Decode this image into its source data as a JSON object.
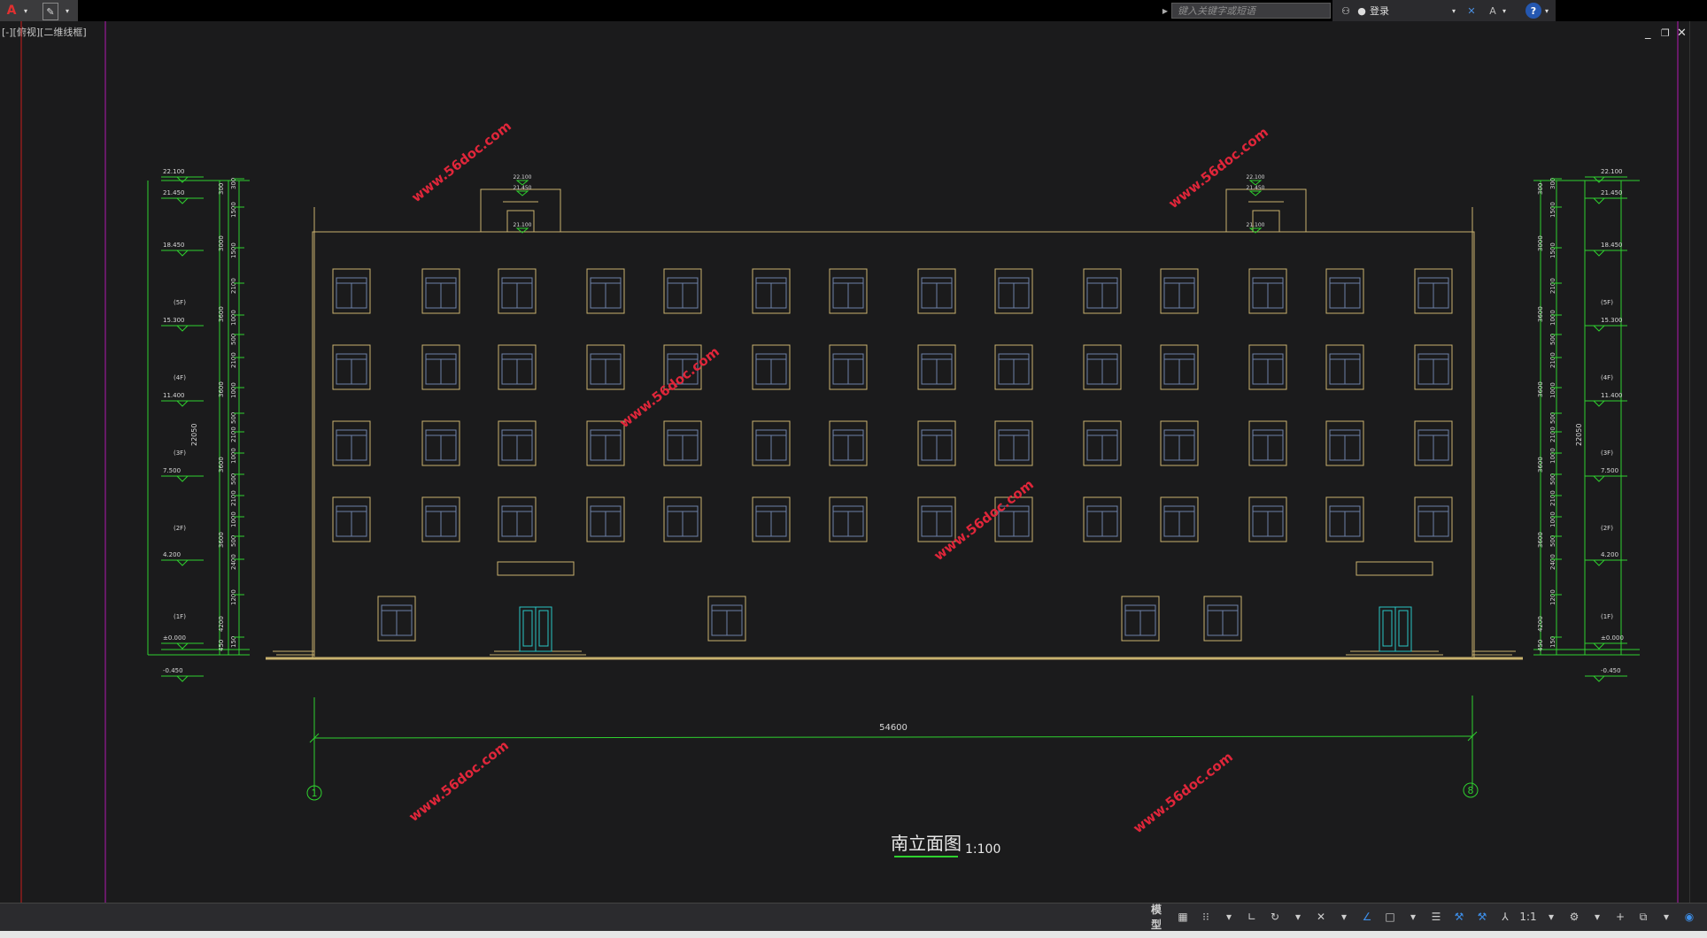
{
  "toolbar": {
    "app_menu_icon": "autocad-a-icon",
    "search_placeholder": "键入关键字或短语",
    "login_label": "登录"
  },
  "viewport": {
    "label": "[-][俯视][二维线框]"
  },
  "drawing": {
    "title": "南立面图",
    "scale": "1:100",
    "overall_dimension": "54600",
    "axis_left": "1",
    "axis_right": "8",
    "watermark": "www.56doc.com",
    "left_total_height": "22050",
    "right_total_height": "22050",
    "levels_left": [
      "22.100",
      "21.450",
      "18.450",
      "15.300",
      "11.400",
      "7.500",
      "4.200",
      "±0.000",
      "-0.450"
    ],
    "levels_right": [
      "22.100",
      "21.450",
      "18.450",
      "15.300",
      "11.400",
      "7.500",
      "4.200",
      "±0.000",
      "-0.450"
    ],
    "floor_labels": [
      "(5F)",
      "(4F)",
      "(3F)",
      "(2F)",
      "(1F)"
    ],
    "left_dims_inner": [
      "300",
      "1500",
      "1500",
      "2100",
      "1000",
      "500",
      "2100",
      "1000",
      "500",
      "2100",
      "1000",
      "500",
      "2100",
      "1000",
      "500",
      "2400",
      "1200",
      "150"
    ],
    "left_dims_outer": [
      "300",
      "3000",
      "3600",
      "3600",
      "3600",
      "3600",
      "4200",
      "450"
    ],
    "roof_levels": [
      "22.100",
      "21.450",
      "21.100"
    ]
  },
  "statusbar": {
    "model_label": "模型",
    "scale_label": "1:1"
  },
  "colors": {
    "building": "#c8b26e",
    "dimension": "#2fd12f",
    "window_frame": "#6e82a8",
    "door": "#28c4c4",
    "watermark": "#e0263a",
    "magenta_line": "#b018b0",
    "red_line": "#c81c1c"
  }
}
